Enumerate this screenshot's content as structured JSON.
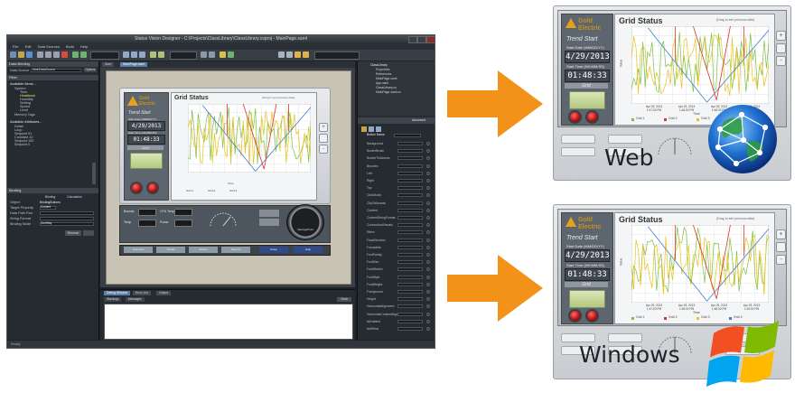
{
  "designer": {
    "window_title": "Status Vision Designer - C:\\Projects\\ClassLibrary\\ClassLibrary.csproj - MainPage.xaml",
    "menu": [
      "File",
      "Edit",
      "Data Sources",
      "Build",
      "Help"
    ],
    "tabs": [
      "Start",
      "MainPage.xaml"
    ],
    "left_panel": {
      "data_binding_header": "Data Binding",
      "data_source_label": "Data Source",
      "data_source_value": "MainDataSource",
      "options_label": "Options",
      "filter_header": "Filter",
      "available_items_label": "Available Items...",
      "tree_items": [
        "System",
        "Time",
        "Heartbeat",
        "Humidity",
        "Setting",
        "Speed",
        "Level",
        "Memory Tags"
      ],
      "attributes_label": "Available Attributes...",
      "attributes": [
        "Detail",
        "Loop",
        "Setpoint 01",
        "Constant 10",
        "Setpoint 100",
        "Setpoint 0"
      ],
      "binding_header": "Binding",
      "binding_label": "Binding",
      "calculation_label": "Calculation",
      "object_label": "Object",
      "object_value": "BindingButtons",
      "target_property_label": "Target Property",
      "target_property_value": "Content",
      "path_label": "Data Path Part",
      "format_label": "String Format",
      "binding_mode_label": "Binding Mode",
      "binding_mode_value": "OneWay",
      "remove_button": "Remove"
    },
    "bottom_panel": {
      "tabs": [
        "Debug Window",
        "Error List",
        "Output"
      ],
      "messages_tab": "Messages",
      "warnings_tab": "Warnings",
      "clear_button": "Clear"
    },
    "right_panel": {
      "tree": [
        "ClassLibrary",
        "Properties",
        "References",
        "MainPage.xaml",
        "App.xaml",
        "ClassLibrary.cs",
        "MainPage.xaml.cs"
      ],
      "properties_header": "Advanced",
      "button_name_label": "Button Name",
      "properties": [
        "Background",
        "BorderBrush",
        "BorderThickness",
        "Brushes",
        "Left",
        "Right",
        "Top",
        "ClickMode",
        "ClipToBounds",
        "Content",
        "ContentStringFormat",
        "CursorsAndVisuals",
        "Effect",
        "FlowDirection",
        "Focusable",
        "FontFamily",
        "FontSize",
        "FontStretch",
        "FontStyle",
        "FontWeight",
        "Foreground",
        "Height",
        "HorizontalAlignment",
        "HorizontalContentAlignment",
        "IsEnabled",
        "IsHitTest"
      ]
    },
    "status_bar": "Ready",
    "mini_labels": [
      "Bounds",
      "CPU Temp",
      "Temp",
      "Power"
    ],
    "gauge_label": "VantagePoint",
    "bottom_buttons": [
      "Overview",
      "Trends",
      "Alarms",
      "Reports",
      "Setup",
      "Help"
    ]
  },
  "screens": {
    "logo_line1": "Gold",
    "logo_line2": "Electric",
    "trend_start": "Trend Start",
    "start_date_label": "Start Date (MM/DD/YY)",
    "date_value": "4/29/2013",
    "start_time_label": "Start Time (HH:MM:SS)",
    "time_value": "01:48:33",
    "grid_caption": "Grid",
    "chart_title": "Grid Status",
    "drag_hint": "(Drag to see previous data)",
    "y_axis_label": "Value",
    "x_axis_label": "Time",
    "x_ticks": [
      "Apr 29, 2013\n1:47:30 PM",
      "Apr 29, 2013\n1:48:00 PM",
      "Apr 29, 2013\n1:48:30 PM",
      "Apr 29, 2013\n1:49:00 PM"
    ],
    "legend": [
      "Grid 1",
      "Grid 2",
      "Grid 3",
      "Grid 4"
    ],
    "side_buttons": [
      "+",
      "-"
    ],
    "web_label": "Web",
    "windows_label": "Windows"
  },
  "colors": {
    "arrow": "#f39219",
    "series_green": "#7bc043",
    "series_red": "#d9342b",
    "series_blue": "#3b7fd1",
    "series_yellow": "#e8c21a"
  },
  "icons": {
    "web": "globe-network-icon",
    "windows": "windows-logo-icon",
    "arrows": "right-arrow-icon"
  }
}
